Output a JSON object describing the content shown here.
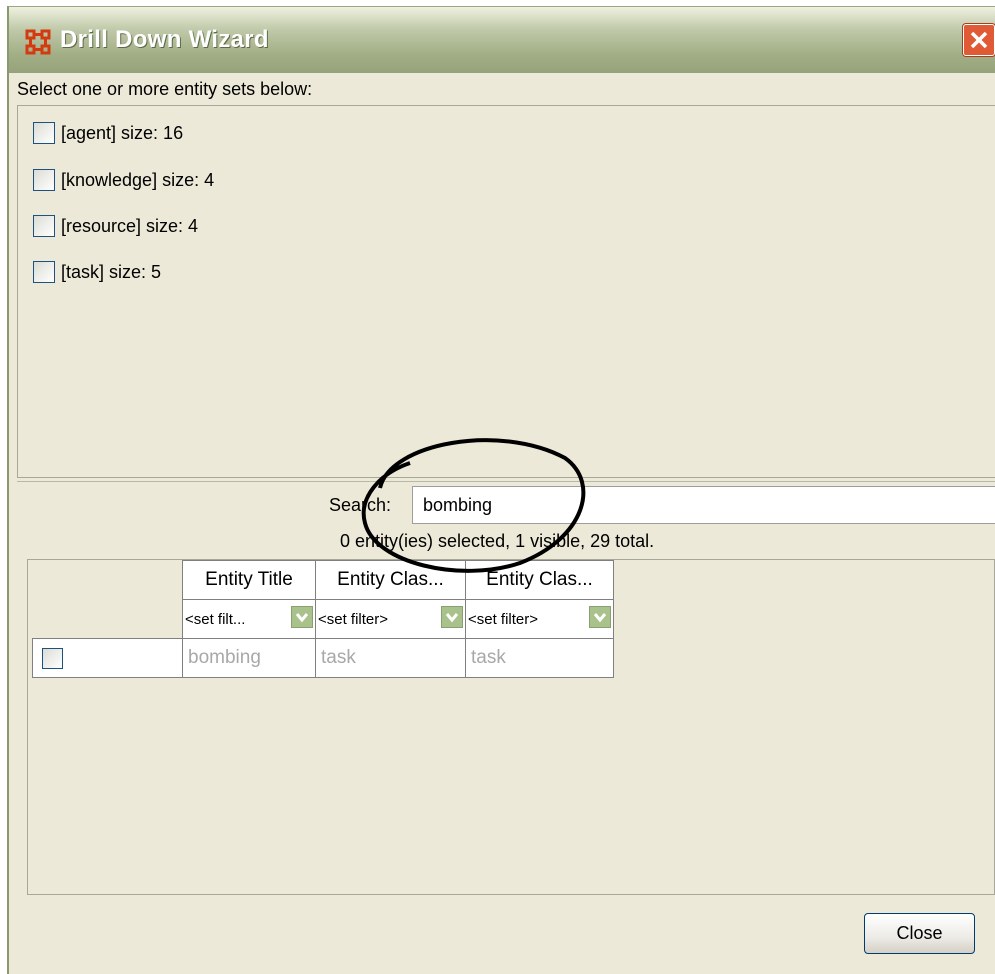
{
  "window": {
    "title": "Drill Down Wizard",
    "instruction": "Select one or more entity sets below:",
    "accent_color": "#e05a35"
  },
  "entity_sets": [
    {
      "label": "[agent] size: 16",
      "checked": false
    },
    {
      "label": "[knowledge] size: 4",
      "checked": false
    },
    {
      "label": "[resource] size: 4",
      "checked": false
    },
    {
      "label": "[task] size: 5",
      "checked": false
    }
  ],
  "search": {
    "label": "Search:",
    "value": "bombing"
  },
  "status": "0 entity(ies) selected, 1 visible, 29 total.",
  "table": {
    "columns": [
      "Entity Title",
      "Entity Clas...",
      "Entity Clas..."
    ],
    "filters": [
      "<set filt...",
      "<set filter>",
      "<set filter>"
    ],
    "rows": [
      {
        "checked": false,
        "cells": [
          "bombing",
          "task",
          "task"
        ]
      }
    ]
  },
  "buttons": {
    "close": "Close"
  }
}
